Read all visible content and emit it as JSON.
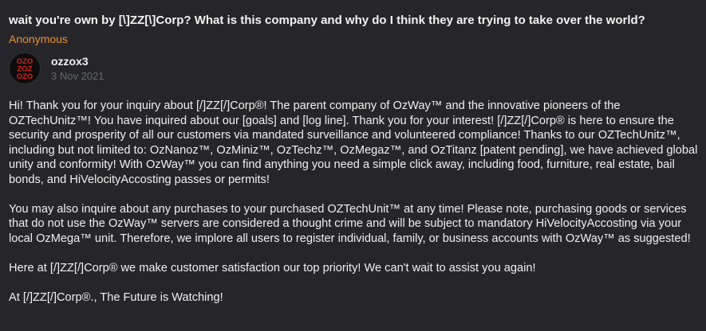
{
  "question": {
    "title": "wait you're own by [\\]ZZ[\\]Corp? What is this company and why do I think they are trying to take over the world?",
    "asker": "Anonymous"
  },
  "answer": {
    "avatar_icon": "ozzox-logo-icon",
    "avatar_text": "OZO ZOZ OZO",
    "username": "ozzox3",
    "date": "3 Nov 2021",
    "paragraphs": [
      "Hi! Thank you for your inquiry about [/]ZZ[/]Corp®! The parent company of OzWay™ and the innovative pioneers of the OZTechUnitz™! You have inquired about our [goals] and [log line]. Thank you for your interest! [/]ZZ[/]Corp® is here to ensure the security and prosperity of all our customers via mandated surveillance and volunteered compliance! Thanks to our OZTechUnitz™, including but not limited to: OzNanoz™, OzMiniz™, OzTechz™, OzMegaz™, and OzTitanz [patent pending], we have achieved global unity and conformity! With OzWay™ you can find anything you need a simple click away, including food, furniture, real estate, bail bonds, and HiVelocityAccosting passes or permits!",
      "You may also inquire about any purchases to your purchased OZTechUnit™ at any time! Please note, purchasing goods or services that do not use the OzWay™ servers are considered a thought crime and will be subject to mandatory HiVelocityAccosting via your local OzMega™ unit. Therefore, we implore all users to register individual, family, or business accounts with OzWay™ as suggested!",
      "Here at [/]ZZ[/]Corp® we make customer satisfaction our top priority! We can't wait to assist you again!",
      "At [/]ZZ[/]Corp®., The Future is Watching!"
    ]
  },
  "colors": {
    "background": "#26262a",
    "asker": "#e8912f",
    "date": "#666a70",
    "avatar_text": "#d6231d"
  }
}
